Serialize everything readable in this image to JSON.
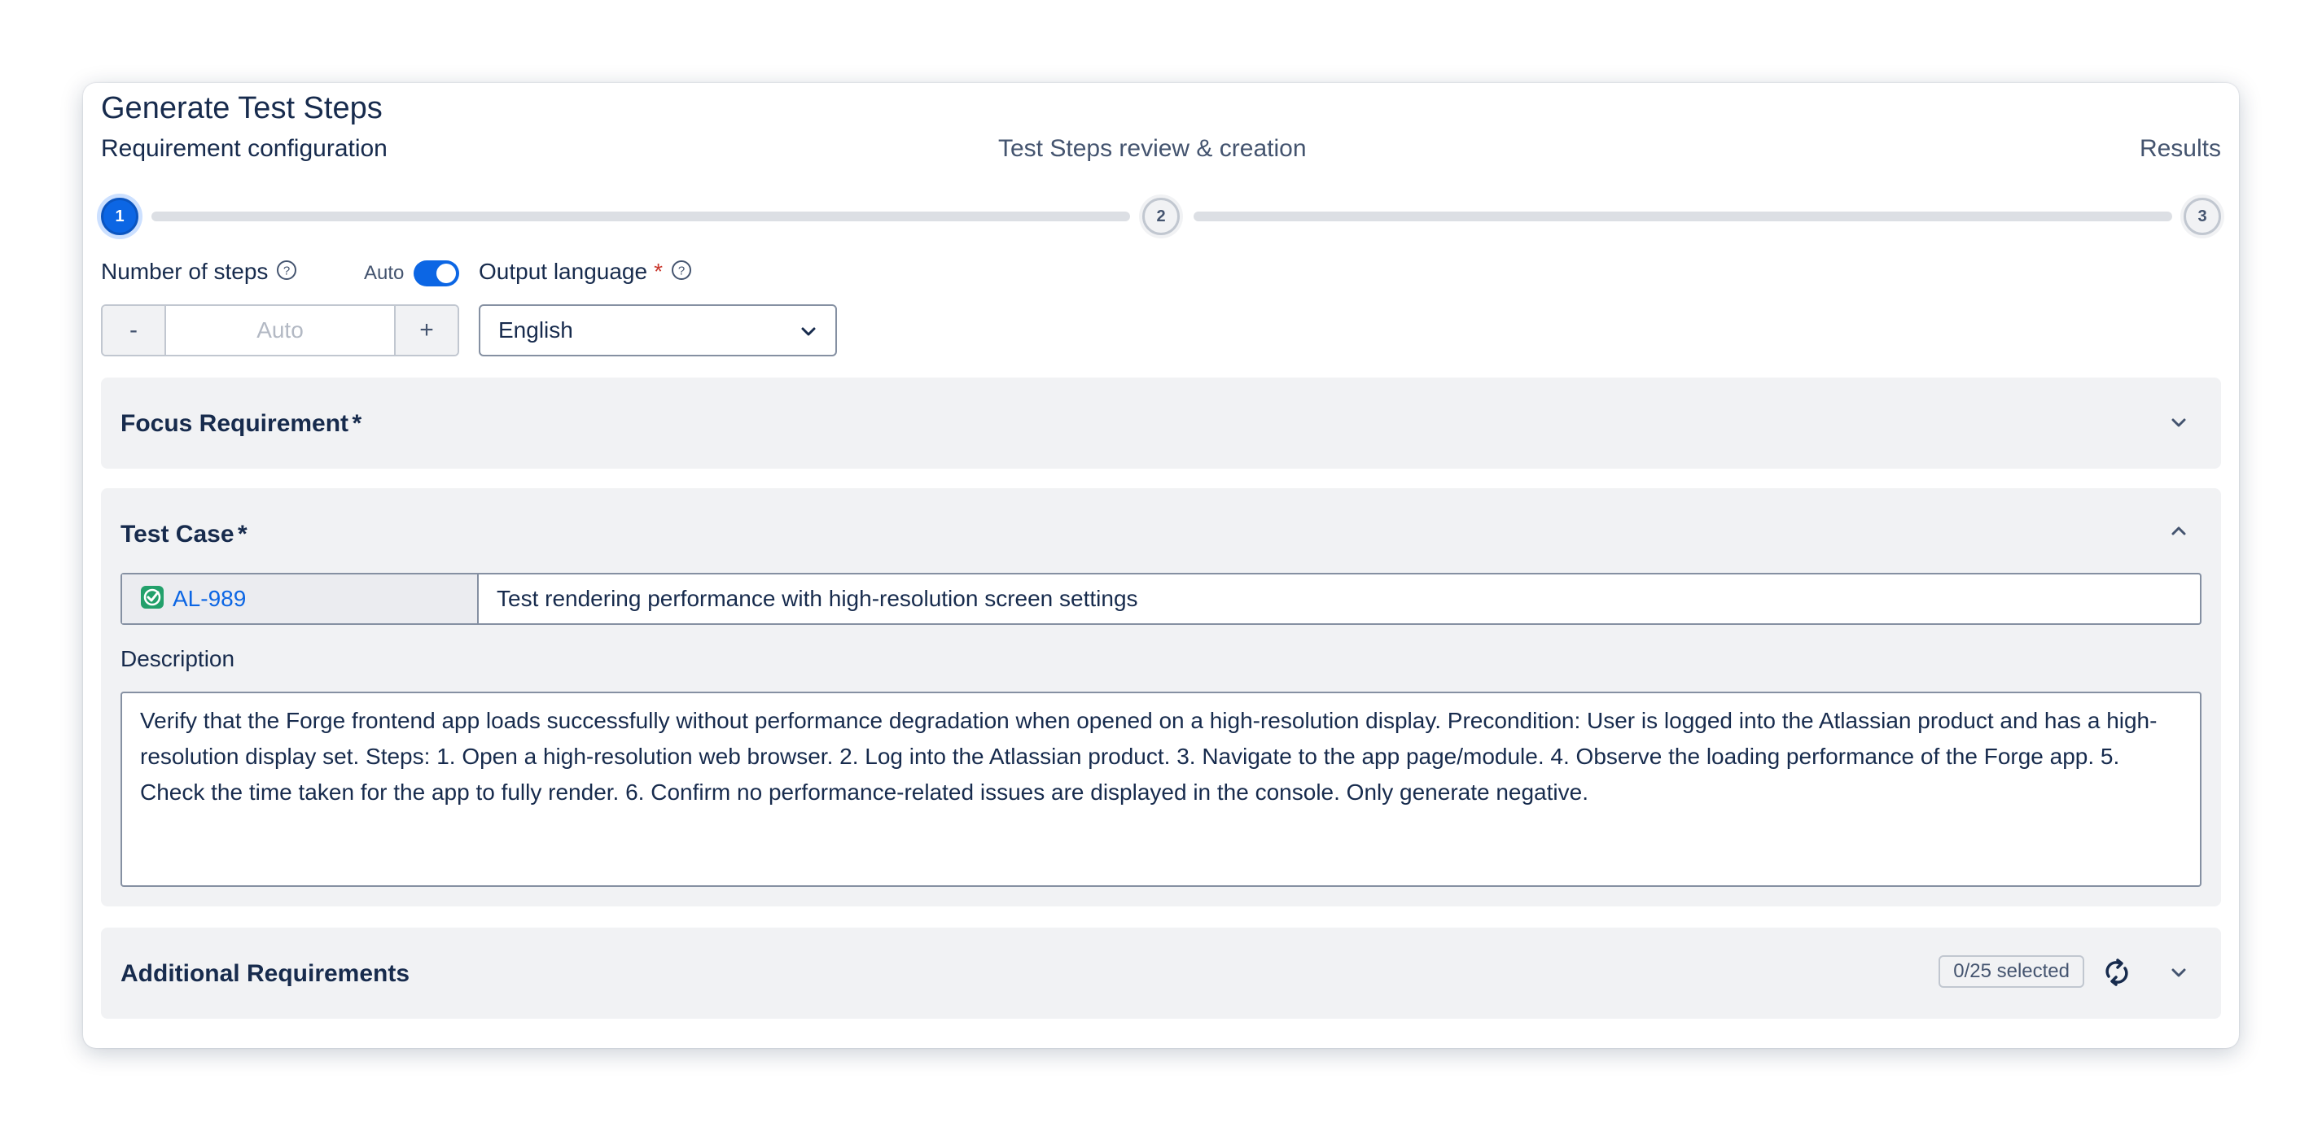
{
  "header": {
    "title": "Generate Test Steps"
  },
  "stepper": {
    "steps": [
      {
        "number": "1",
        "label": "Requirement configuration",
        "state": "active"
      },
      {
        "number": "2",
        "label": "Test Steps review & creation",
        "state": "upcoming"
      },
      {
        "number": "3",
        "label": "Results",
        "state": "upcoming"
      }
    ]
  },
  "config": {
    "number_of_steps_label": "Number of steps",
    "auto_toggle_label": "Auto",
    "auto_toggle_on": true,
    "steps_input_placeholder": "Auto",
    "decrement_label": "-",
    "increment_label": "+",
    "output_language_label": "Output language",
    "output_language_value": "English"
  },
  "focus_requirement": {
    "title": "Focus Requirement",
    "required_mark": "*",
    "expanded": false
  },
  "test_case": {
    "title": "Test Case",
    "required_mark": "*",
    "expanded": true,
    "key": "AL-989",
    "summary": "Test rendering performance with high-resolution screen settings",
    "description_label": "Description",
    "description": "Verify that the Forge frontend app loads successfully without performance degradation when opened on a high-resolution display. Precondition: User is logged into the Atlassian product and has a high-resolution display set. Steps: 1. Open a high-resolution web browser. 2. Log into the Atlassian product. 3. Navigate to the app page/module. 4. Observe the loading performance of the Forge app. 5. Check the time taken for the app to fully render. 6. Confirm no performance-related issues are displayed in the console. Only generate negative."
  },
  "additional_requirements": {
    "title": "Additional Requirements",
    "selected_badge": "0/25 selected",
    "expanded": false
  },
  "colors": {
    "accent": "#0c66e4",
    "required": "#c9372c",
    "panel_bg": "#f1f2f4",
    "test_icon": "#22a06b"
  },
  "icons": [
    "help-icon",
    "chevron-down-icon",
    "chevron-up-icon",
    "test-case-icon",
    "refresh-icon"
  ]
}
